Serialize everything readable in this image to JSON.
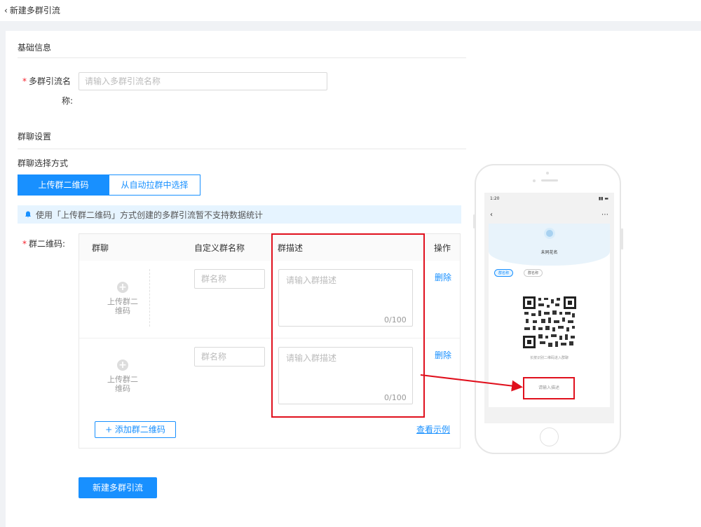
{
  "header": {
    "back_label": "新建多群引流"
  },
  "basic": {
    "section_title": "基础信息",
    "name_label_1": "多群引流名",
    "name_label_2": "称:",
    "name_placeholder": "请输入多群引流名称"
  },
  "group_settings": {
    "section_title": "群聊设置",
    "select_mode_label": "群聊选择方式",
    "tab_upload": "上传群二维码",
    "tab_auto": "从自动拉群中选择",
    "notice": "使用「上传群二维码」方式创建的多群引流暂不支持数据统计",
    "qr_label": "群二维码:"
  },
  "table": {
    "headers": [
      "群聊",
      "自定义群名称",
      "群描述",
      "操作"
    ],
    "rows": [
      {
        "upload_label": "上传群二维码",
        "name_placeholder": "群名称",
        "desc_placeholder": "请输入群描述",
        "counter": "0/100",
        "delete": "删除"
      },
      {
        "upload_label": "上传群二维码",
        "name_placeholder": "群名称",
        "desc_placeholder": "请输入群描述",
        "counter": "0/100",
        "delete": "删除"
      }
    ],
    "add_button": "+ 添加群二维码",
    "example_link": "查看示例"
  },
  "submit_button": "新建多群引流",
  "phone_preview": {
    "time": "1:20",
    "profile_name": "未同花名",
    "chip_1": "群名称",
    "chip_2": "群名称",
    "hint": "长按识别二维码进入群聊",
    "desc_placeholder": "请输入描述"
  },
  "colors": {
    "primary": "#1890ff",
    "highlight": "#e0101d",
    "required": "#f5222d"
  }
}
